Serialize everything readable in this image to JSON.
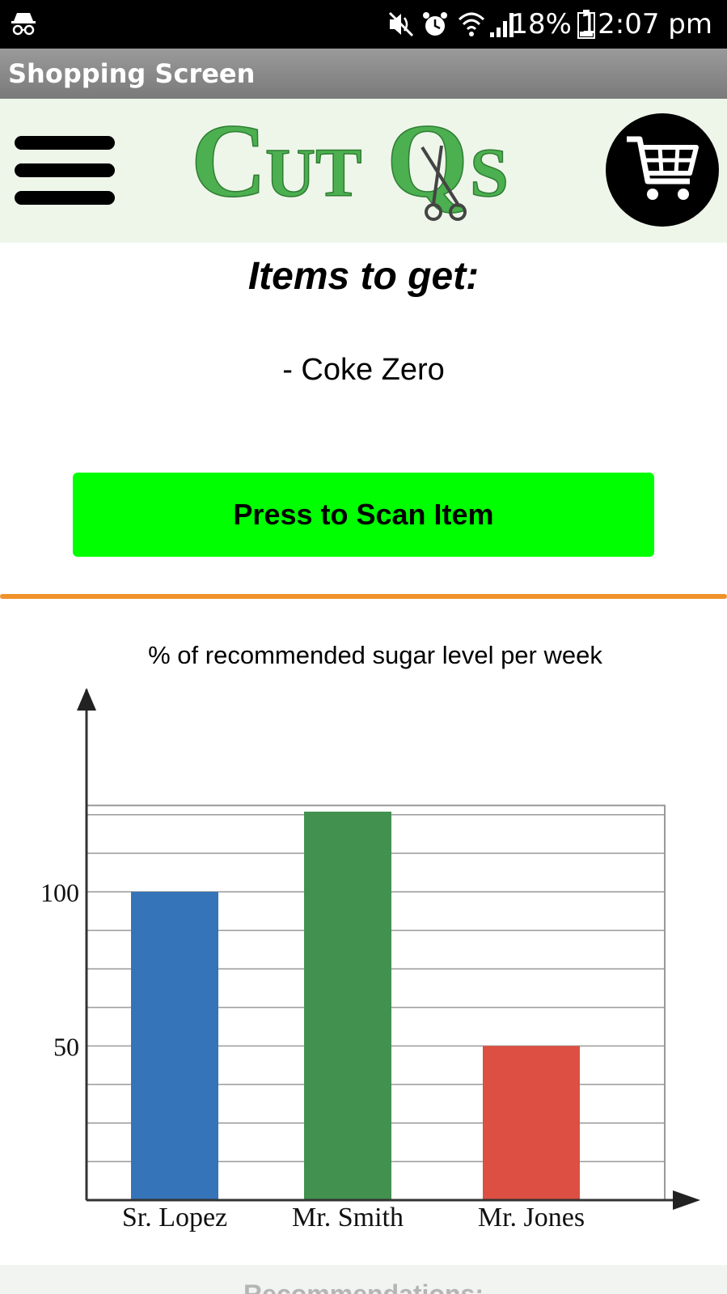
{
  "status_bar": {
    "battery": "18%",
    "time": "12:07 pm",
    "icons": [
      "incognito-icon",
      "mute-icon",
      "alarm-icon",
      "wifi-icon",
      "signal-icon",
      "battery-icon"
    ]
  },
  "app": {
    "title": "Shopping Screen"
  },
  "header": {
    "logo": "CutQs",
    "menu_icon": "hamburger-menu-icon",
    "cart_icon": "shopping-cart-icon",
    "logo_color": "#4caf50"
  },
  "shopping": {
    "items_title": "Items to get:",
    "items": [
      "- Coke Zero"
    ],
    "scan_button": "Press to Scan Item",
    "button_color": "#00ff00",
    "divider_color": "#f0922a"
  },
  "chart_data": {
    "type": "bar",
    "title": "% of recommended sugar level per week",
    "categories": [
      "Sr. Lopez",
      "Mr. Smith",
      "Mr. Jones"
    ],
    "values": [
      100,
      126,
      50
    ],
    "colors": [
      "#3574b8",
      "#42914f",
      "#dc4f42"
    ],
    "y_ticks": [
      50,
      100
    ],
    "ylim": [
      0,
      128
    ],
    "grid": true
  },
  "footer": {
    "recommendations_label": "Recommendations:"
  }
}
